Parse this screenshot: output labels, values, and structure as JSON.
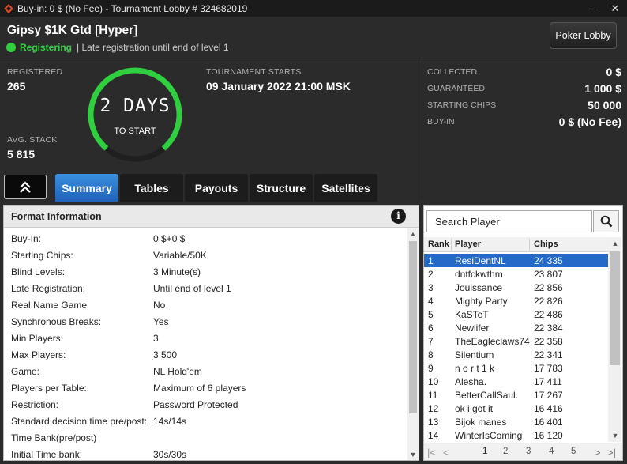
{
  "window": {
    "title": "Buy-in: 0 $ (No Fee) - Tournament Lobby # 324682019",
    "minimize_glyph": "—",
    "close_glyph": "✕"
  },
  "header": {
    "tournament_name": "Gipsy $1K Gtd [Hyper]",
    "status": "Registering",
    "status_note": "| Late registration until end of level 1",
    "lobby_button": "Poker Lobby"
  },
  "stats": {
    "registered_label": "REGISTERED",
    "registered_value": "265",
    "avg_stack_label": "AVG. STACK",
    "avg_stack_value": "5 815",
    "countdown_value": "2 DAYS",
    "countdown_label": "TO START",
    "starts_label": "TOURNAMENT STARTS",
    "starts_value": "09 January 2022  21:00 MSK"
  },
  "prize_info": [
    {
      "label": "COLLECTED",
      "value": "0 $"
    },
    {
      "label": "GUARANTEED",
      "value": "1 000 $"
    },
    {
      "label": "STARTING CHIPS",
      "value": "50 000"
    },
    {
      "label": "BUY-IN",
      "value": "0 $ (No Fee)"
    }
  ],
  "tabs": [
    {
      "label": "Summary",
      "active": true
    },
    {
      "label": "Tables",
      "active": false
    },
    {
      "label": "Payouts",
      "active": false
    },
    {
      "label": "Structure",
      "active": false
    },
    {
      "label": "Satellites",
      "active": false
    }
  ],
  "format": {
    "title": "Format Information",
    "info_glyph": "i",
    "rows": [
      {
        "label": "Buy-In:",
        "value": "0 $+0 $"
      },
      {
        "label": "Starting Chips:",
        "value": "Variable/50K"
      },
      {
        "label": "Blind Levels:",
        "value": "3 Minute(s)"
      },
      {
        "label": "Late Registration:",
        "value": "Until end of level 1"
      },
      {
        "label": "Real Name Game",
        "value": "No"
      },
      {
        "label": "Synchronous Breaks:",
        "value": "Yes"
      },
      {
        "label": "Min Players:",
        "value": "3"
      },
      {
        "label": "Max Players:",
        "value": "3 500"
      },
      {
        "label": "Game:",
        "value": "NL Hold'em"
      },
      {
        "label": "Players per Table:",
        "value": "Maximum of 6 players"
      },
      {
        "label": "Restriction:",
        "value": "Password Protected"
      },
      {
        "label": "Standard decision time pre/post:",
        "value": "14s/14s"
      },
      {
        "label": "Time Bank(pre/post)",
        "value": ""
      },
      {
        "label": "Initial Time bank:",
        "value": "30s/30s"
      }
    ]
  },
  "players": {
    "search_placeholder": "Search Player",
    "columns": {
      "rank": "Rank",
      "player": "Player",
      "chips": "Chips"
    },
    "rows": [
      {
        "rank": "1",
        "player": "ResiDentNL",
        "chips": "24 335",
        "selected": true
      },
      {
        "rank": "2",
        "player": "dntfckwthm",
        "chips": "23 807"
      },
      {
        "rank": "3",
        "player": "Jouissance",
        "chips": "22 856"
      },
      {
        "rank": "4",
        "player": "Mighty Party",
        "chips": "22 826"
      },
      {
        "rank": "5",
        "player": "KaSTeT",
        "chips": "22 486"
      },
      {
        "rank": "6",
        "player": "Newlifer",
        "chips": "22 384"
      },
      {
        "rank": "7",
        "player": "TheEagleclaws74",
        "chips": "22 358"
      },
      {
        "rank": "8",
        "player": "Silentium",
        "chips": "22 341"
      },
      {
        "rank": "9",
        "player": "n o r t 1 k",
        "chips": "17 783"
      },
      {
        "rank": "10",
        "player": "Alesha.",
        "chips": "17 411"
      },
      {
        "rank": "11",
        "player": "BetterCallSaul.",
        "chips": "17 267"
      },
      {
        "rank": "12",
        "player": "ok i got it",
        "chips": "16 416"
      },
      {
        "rank": "13",
        "player": "Bijok manes",
        "chips": "16 401"
      },
      {
        "rank": "14",
        "player": "WinterIsComing",
        "chips": "16 120"
      }
    ],
    "pages": [
      "1",
      "2",
      "3",
      "4",
      "5"
    ],
    "current_page": "1"
  },
  "colors": {
    "accent_blue": "#2468c8",
    "status_green": "#35d246",
    "dark_bg": "#2b2b2b"
  }
}
